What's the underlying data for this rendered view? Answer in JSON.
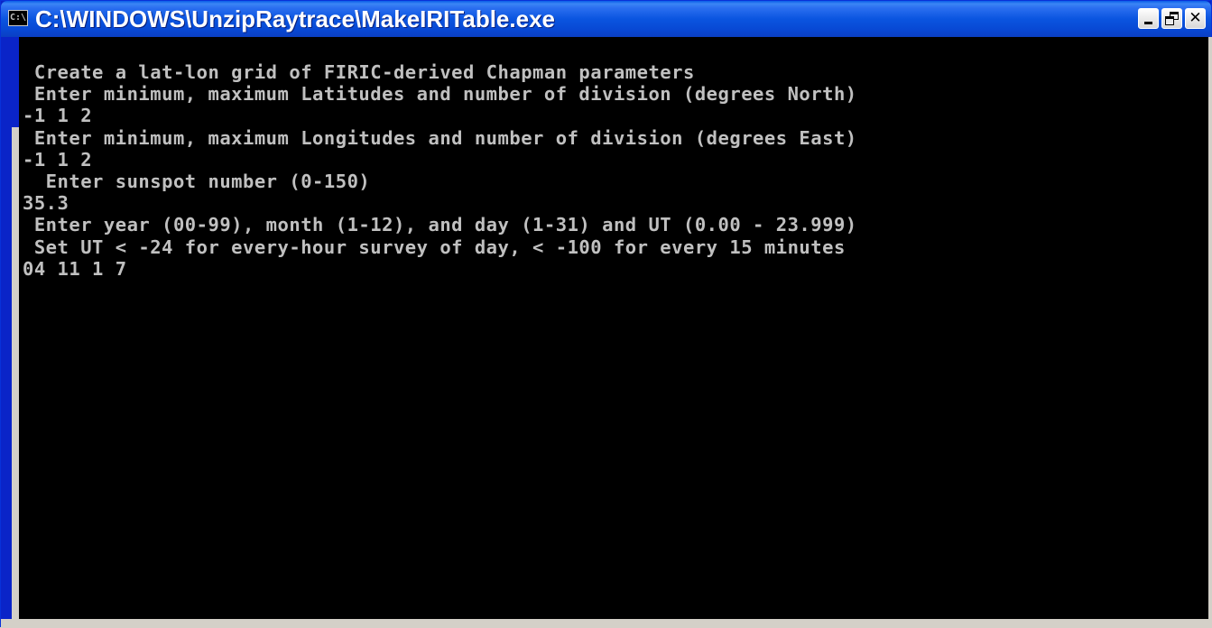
{
  "window": {
    "title": "C:\\WINDOWS\\UnzipRaytrace\\MakeIRITable.exe",
    "icon_label": "C:\\",
    "controls": {
      "minimize_icon": "minimize-icon",
      "maximize_icon": "restore-icon",
      "close_icon": "close-icon",
      "close_glyph": "✕"
    }
  },
  "console": {
    "lines": [
      " Create a lat-lon grid of FIRIC-derived Chapman parameters",
      " Enter minimum, maximum Latitudes and number of division (degrees North)",
      "-1 1 2",
      " Enter minimum, maximum Longitudes and number of division (degrees East)",
      "-1 1 2",
      "  Enter sunspot number (0-150)",
      "35.3",
      " Enter year (00-99), month (1-12), and day (1-31) and UT (0.00 - 23.999)",
      " Set UT < -24 for every-hour survey of day, < -100 for every 15 minutes",
      "04 11 1 7"
    ]
  },
  "colors": {
    "title_bar": "#0a55e0",
    "console_background": "#000000",
    "console_text": "#c0c0c0"
  }
}
